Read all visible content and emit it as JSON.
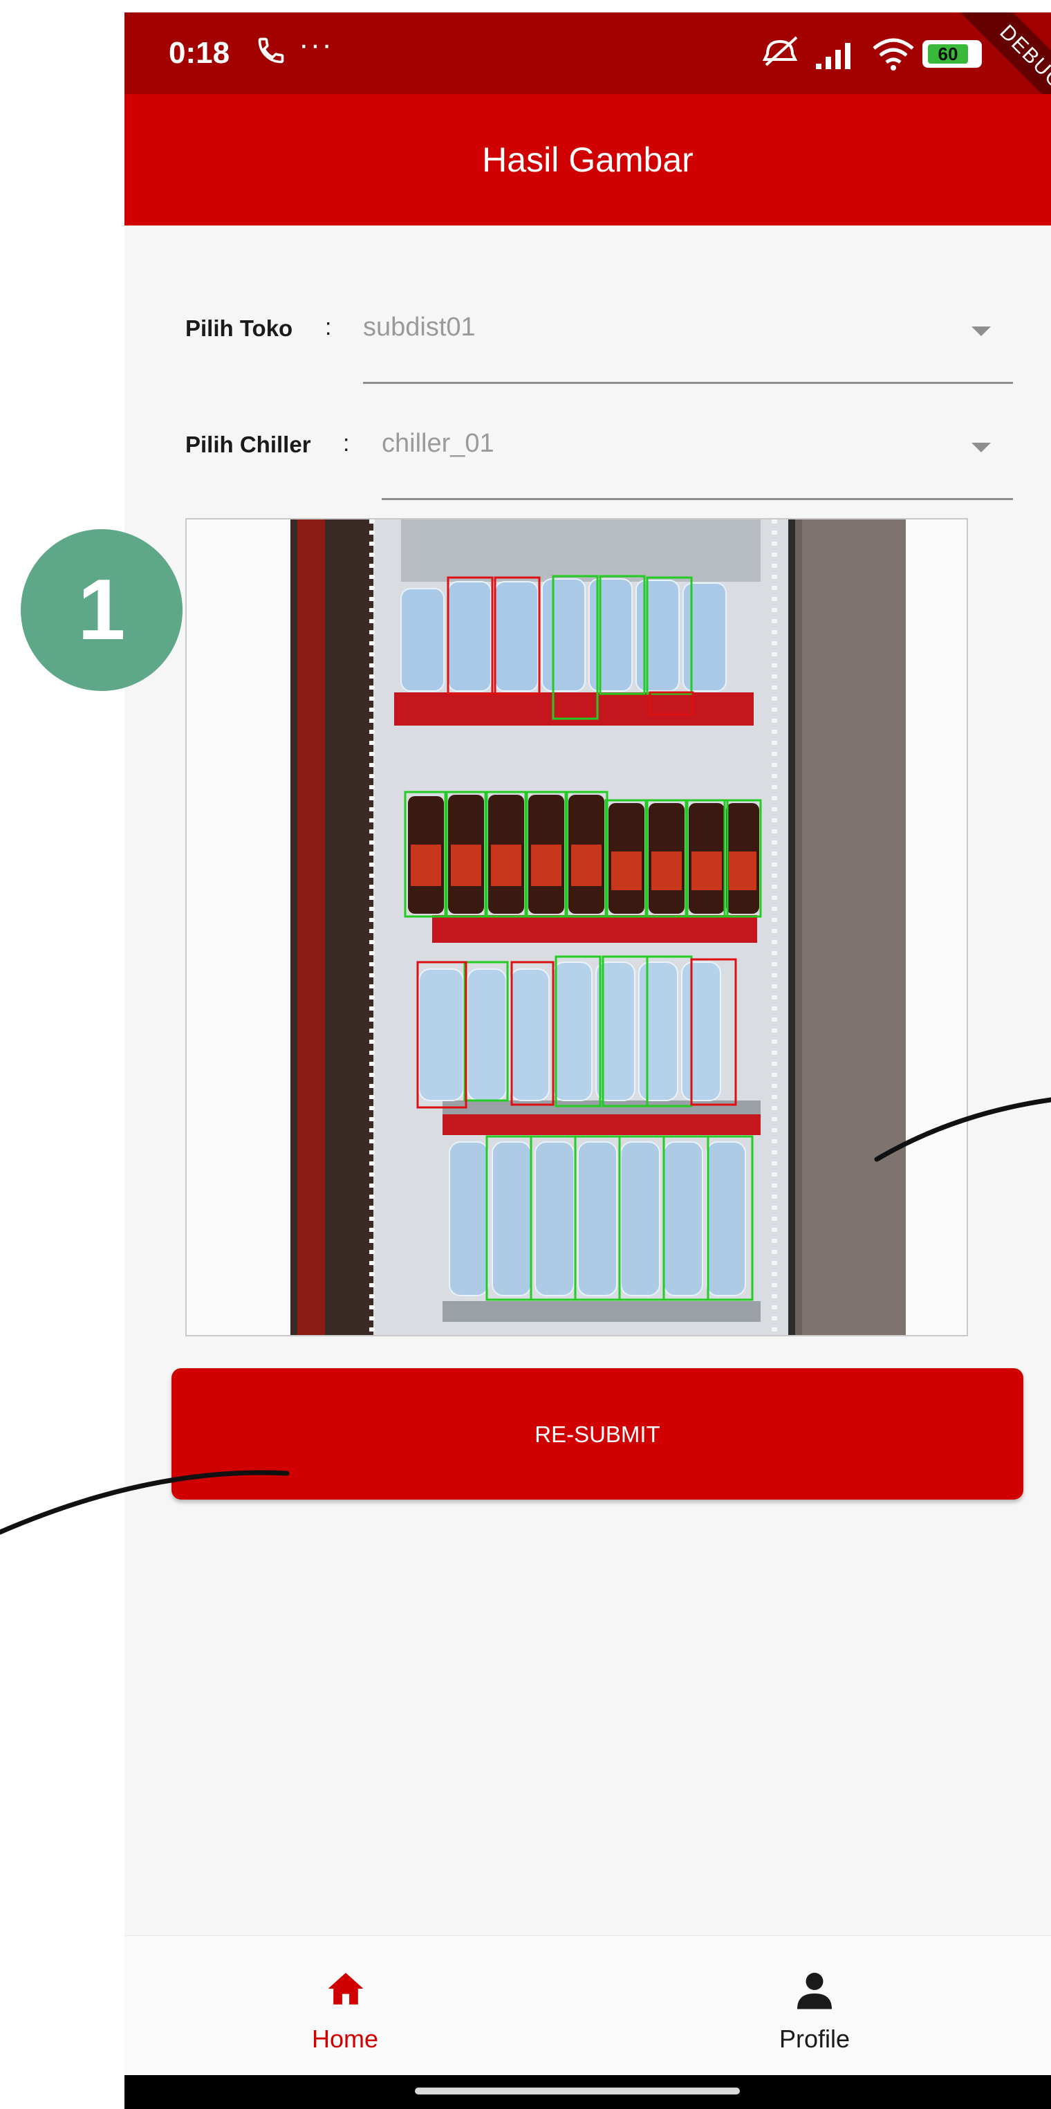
{
  "status_bar": {
    "time": "0:18",
    "more": "···",
    "battery_level": "60",
    "debug_label": "DEBUG"
  },
  "app_bar": {
    "title": "Hasil Gambar"
  },
  "form": {
    "toko": {
      "label": "Pilih Toko",
      "separator": ":",
      "value": "subdist01"
    },
    "chiller": {
      "label": "Pilih Chiller",
      "separator": ":",
      "value": "chiller_01"
    }
  },
  "action": {
    "resubmit_label": "RE-SUBMIT"
  },
  "bottom_nav": {
    "items": [
      {
        "label": "Home",
        "icon": "home-icon",
        "active": true
      },
      {
        "label": "Profile",
        "icon": "person-icon",
        "active": false
      }
    ]
  },
  "annotation": {
    "step_number": "1"
  },
  "colors": {
    "primary": "#d10000",
    "status_bar": "#a30000",
    "badge": "#5ea788",
    "active_nav": "#d10000",
    "detection_box_ok": "#22cc22",
    "detection_box_alert": "#dd1111"
  }
}
